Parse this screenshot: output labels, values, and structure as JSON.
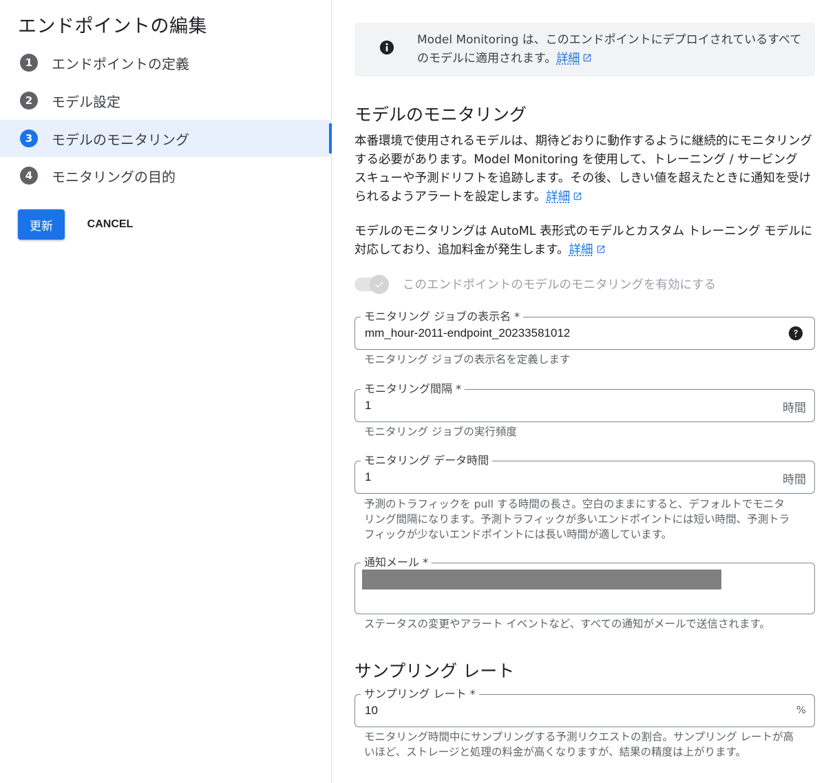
{
  "sidebar": {
    "title": "エンドポイントの編集",
    "steps": [
      {
        "num": "1",
        "label": "エンドポイントの定義"
      },
      {
        "num": "2",
        "label": "モデル設定"
      },
      {
        "num": "3",
        "label": "モデルのモニタリング"
      },
      {
        "num": "4",
        "label": "モニタリングの目的"
      }
    ],
    "active_step": 3,
    "update_button": "更新",
    "cancel_button": "CANCEL"
  },
  "info_banner": {
    "text": "Model Monitoring は、このエンドポイントにデプロイされているすべてのモデルに適用されます。",
    "link": "詳細"
  },
  "monitoring_section": {
    "heading": "モデルのモニタリング",
    "description": "本番環境で使用されるモデルは、期待どおりに動作するように継続的にモニタリングする必要があります。Model Monitoring を使用して、トレーニング / サービング スキューや予測ドリフトを追跡します。その後、しきい値を超えたときに通知を受けられるようアラートを設定します。",
    "description_link": "詳細",
    "support_note": "モデルのモニタリングは AutoML 表形式のモデルとカスタム トレーニング モデルに対応しており、追加料金が発生します。",
    "support_link": "詳細",
    "toggle_label": "このエンドポイントのモデルのモニタリングを有効にする",
    "toggle_on": true
  },
  "fields": {
    "job_name": {
      "label": "モニタリング ジョブの表示名 *",
      "value": "mm_hour-2011-endpoint_20233581012",
      "hint": "モニタリング ジョブの表示名を定義します"
    },
    "interval": {
      "label": "モニタリング間隔 *",
      "value": "1",
      "suffix": "時間",
      "hint": "モニタリング ジョブの実行頻度"
    },
    "data_window": {
      "label": "モニタリング データ時間",
      "value": "1",
      "suffix": "時間",
      "hint": "予測のトラフィックを pull する時間の長さ。空白のままにすると、デフォルトでモニタリング間隔になります。予測トラフィックが多いエンドポイントには短い時間、予測トラフィックが少ないエンドポイントには長い時間が適しています。"
    },
    "email": {
      "label": "通知メール *",
      "hint": "ステータスの変更やアラート イベントなど、すべての通知がメールで送信されます。"
    }
  },
  "sampling_section": {
    "heading": "サンプリング レート",
    "rate": {
      "label": "サンプリング レート *",
      "value": "10",
      "suffix": "%",
      "hint": "モニタリング時間中にサンプリングする予測リクエストの割合。サンプリング レートが高いほど、ストレージと処理の料金が高くなりますが、結果の精度は上がります。"
    }
  },
  "colors": {
    "accent": "#1a73e8",
    "active_bg": "#e8f0fe",
    "banner_bg": "#f1f3f4",
    "step_badge": "#5f6368"
  }
}
